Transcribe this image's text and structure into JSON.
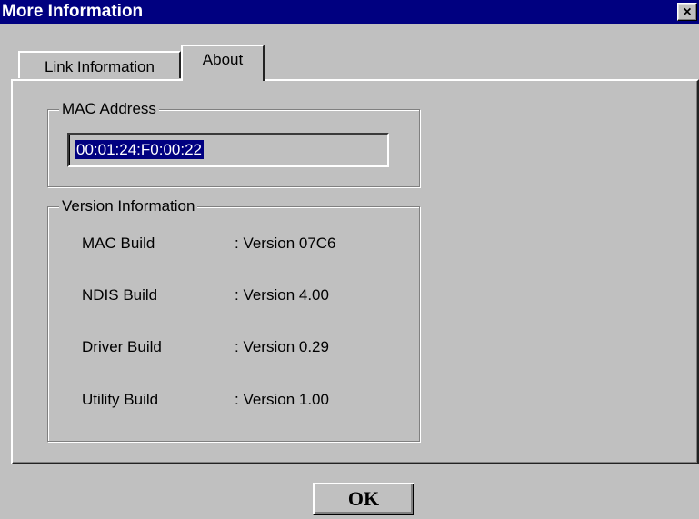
{
  "window": {
    "title": "More Information",
    "close_glyph": "×"
  },
  "tabs": [
    {
      "label": "Link Information",
      "selected": false
    },
    {
      "label": "About",
      "selected": true
    }
  ],
  "mac_section": {
    "legend": "MAC Address",
    "value": "00:01:24:F0:00:22"
  },
  "version_section": {
    "legend": "Version Information",
    "rows": [
      {
        "label": "MAC Build",
        "value": ": Version 07C6"
      },
      {
        "label": "NDIS Build",
        "value": ": Version 4.00"
      },
      {
        "label": "Driver Build",
        "value": ": Version 0.29"
      },
      {
        "label": "Utility Build",
        "value": ": Version 1.00"
      }
    ]
  },
  "buttons": {
    "ok_label": "OK"
  },
  "colors": {
    "title_bar": "#000080",
    "face": "#c0c0c0",
    "selection": "#000080"
  }
}
